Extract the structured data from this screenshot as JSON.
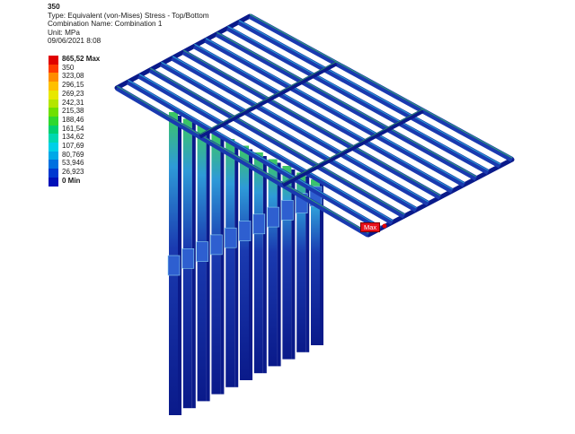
{
  "header": {
    "title": "350",
    "type_line": "Type: Equivalent (von-Mises) Stress - Top/Bottom",
    "combination_line": "Combination Name: Combination 1",
    "unit_line": "Unit: MPa",
    "date_line": "09/06/2021 8:08"
  },
  "legend": {
    "bands": [
      {
        "label": "865,52 Max",
        "color": "#e00000",
        "bold": true
      },
      {
        "label": "350",
        "color": "#ff3b00",
        "bold": false
      },
      {
        "label": "323,08",
        "color": "#ff8c00",
        "bold": false
      },
      {
        "label": "296,15",
        "color": "#ffc000",
        "bold": false
      },
      {
        "label": "269,23",
        "color": "#e8e800",
        "bold": false
      },
      {
        "label": "242,31",
        "color": "#b4e600",
        "bold": false
      },
      {
        "label": "215,38",
        "color": "#6ee000",
        "bold": false
      },
      {
        "label": "188,46",
        "color": "#2ed82e",
        "bold": false
      },
      {
        "label": "161,54",
        "color": "#00d070",
        "bold": false
      },
      {
        "label": "134,62",
        "color": "#00d8b0",
        "bold": false
      },
      {
        "label": "107,69",
        "color": "#00d0e8",
        "bold": false
      },
      {
        "label": "80,769",
        "color": "#00a8e8",
        "bold": false
      },
      {
        "label": "53,946",
        "color": "#0070e0",
        "bold": false
      },
      {
        "label": "26,923",
        "color": "#0038d0",
        "bold": false
      },
      {
        "label": "0 Min",
        "color": "#0010b8",
        "bold": true
      }
    ]
  },
  "probe": {
    "label": "Max"
  },
  "colors": {
    "beam_dark": "#0a1a8a",
    "beam_mid": "#1a3ab0",
    "beam_light": "#2e5fd0",
    "stress_green": "#3cc860",
    "stress_cyan": "#30c8d8"
  }
}
